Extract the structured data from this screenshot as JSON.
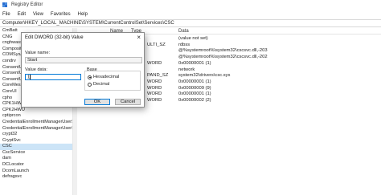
{
  "window": {
    "title": "Registry Editor"
  },
  "menu": [
    "File",
    "Edit",
    "View",
    "Favorites",
    "Help"
  ],
  "address": "Computer\\HKEY_LOCAL_MACHINE\\SYSTEM\\CurrentControlSet\\Services\\CSC",
  "tree": {
    "items": [
      "CmBatt",
      "CNG",
      "cnghwasst",
      "Composit",
      "COMSysA",
      "condrv",
      "ConsentU",
      "ConsentU",
      "ConsentU",
      "CoreMess",
      "CoreUI",
      "cpho",
      "CPK1HWU",
      "CPK2HWU",
      "cptiprcon",
      "CredentialEnrollmentManagerUserSvc",
      "CredentialEnrollmentManagerUserSvc",
      "crypt32",
      "CryptSvc",
      "CSC",
      "CscService",
      "dam",
      "DCLocator",
      "DcomLaunch",
      "defragsvc"
    ],
    "selected_index": 19
  },
  "list": {
    "headers": {
      "name": "Name",
      "type": "Type",
      "data": "Data"
    },
    "rows": [
      {
        "name": "",
        "type": "",
        "data": "(value not set)"
      },
      {
        "name": "",
        "type": "ULTI_SZ",
        "data": "rdbss"
      },
      {
        "name": "",
        "type": "",
        "data": "@%systemroot%\\system32\\cscsvc.dll,-203"
      },
      {
        "name": "",
        "type": "",
        "data": "@%systemroot%\\system32\\cscsvc.dll,-202"
      },
      {
        "name": "",
        "type": "WORD",
        "data": "0x00000001 (1)"
      },
      {
        "name": "",
        "type": "",
        "data": "network"
      },
      {
        "name": "",
        "type": "PAND_SZ",
        "data": "system32\\drivers\\csc.sys"
      },
      {
        "name": "",
        "type": "WORD",
        "data": "0x00000001 (1)"
      },
      {
        "name": "",
        "type": "WORD",
        "data": "0x00000009 (9)"
      },
      {
        "name": "",
        "type": "WORD",
        "data": "0x00000001 (1)"
      },
      {
        "name": "",
        "type": "WORD",
        "data": "0x00000002 (2)"
      }
    ]
  },
  "dialog": {
    "title": "Edit DWORD (32-bit) Value",
    "close_glyph": "×",
    "value_name_label": "Value name:",
    "value_name": "Start",
    "value_data_label": "Value data:",
    "value_data": "1",
    "base_label": "Base",
    "hex_label": "Hexadecimal",
    "dec_label": "Decimal",
    "base_selected": "Hexadecimal",
    "ok_label": "OK",
    "cancel_label": "Cancel"
  }
}
